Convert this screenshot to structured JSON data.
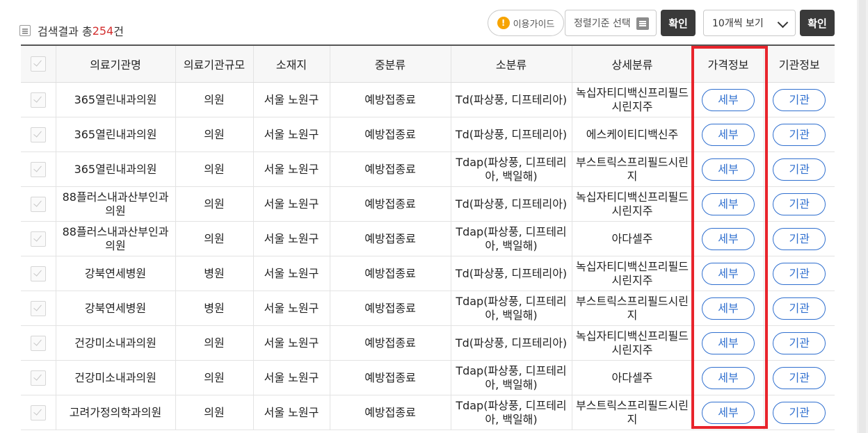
{
  "header": {
    "result_label": "검색결과 총",
    "result_count": "254",
    "result_suffix": "건",
    "guide_label": "이용가이드",
    "sort_label": "정렬기준 선택",
    "confirm_label": "확인",
    "view_label": "10개씩 보기",
    "confirm2_label": "확인"
  },
  "table": {
    "columns": [
      "의료기관명",
      "의료기관규모",
      "소재지",
      "중분류",
      "소분류",
      "상세분류",
      "가격정보",
      "기관정보"
    ],
    "detail_label": "세부",
    "org_label": "기관",
    "rows": [
      {
        "name": "365열린내과의원",
        "scale": "의원",
        "location": "서울 노원구",
        "mid": "예방접종료",
        "sub": "Td(파상풍, 디프테리아)",
        "detail": "녹십자티디백신프리필드시린지주"
      },
      {
        "name": "365열린내과의원",
        "scale": "의원",
        "location": "서울 노원구",
        "mid": "예방접종료",
        "sub": "Td(파상풍, 디프테리아)",
        "detail": "에스케이티디백신주"
      },
      {
        "name": "365열린내과의원",
        "scale": "의원",
        "location": "서울 노원구",
        "mid": "예방접종료",
        "sub": "Tdap(파상풍, 디프테리아, 백일해)",
        "detail": "부스트릭스프리필드시린지"
      },
      {
        "name": "88플러스내과산부인과의원",
        "scale": "의원",
        "location": "서울 노원구",
        "mid": "예방접종료",
        "sub": "Td(파상풍, 디프테리아)",
        "detail": "녹십자티디백신프리필드시린지주"
      },
      {
        "name": "88플러스내과산부인과의원",
        "scale": "의원",
        "location": "서울 노원구",
        "mid": "예방접종료",
        "sub": "Tdap(파상풍, 디프테리아, 백일해)",
        "detail": "아다셀주"
      },
      {
        "name": "강북연세병원",
        "scale": "병원",
        "location": "서울 노원구",
        "mid": "예방접종료",
        "sub": "Td(파상풍, 디프테리아)",
        "detail": "녹십자티디백신프리필드시린지주"
      },
      {
        "name": "강북연세병원",
        "scale": "병원",
        "location": "서울 노원구",
        "mid": "예방접종료",
        "sub": "Tdap(파상풍, 디프테리아, 백일해)",
        "detail": "부스트릭스프리필드시린지"
      },
      {
        "name": "건강미소내과의원",
        "scale": "의원",
        "location": "서울 노원구",
        "mid": "예방접종료",
        "sub": "Td(파상풍, 디프테리아)",
        "detail": "녹십자티디백신프리필드시린지주"
      },
      {
        "name": "건강미소내과의원",
        "scale": "의원",
        "location": "서울 노원구",
        "mid": "예방접종료",
        "sub": "Tdap(파상풍, 디프테리아, 백일해)",
        "detail": "아다셀주"
      },
      {
        "name": "고려가정의학과의원",
        "scale": "의원",
        "location": "서울 노원구",
        "mid": "예방접종료",
        "sub": "Tdap(파상풍, 디프테리아, 백일해)",
        "detail": "부스트릭스프리필드시린지"
      }
    ]
  }
}
